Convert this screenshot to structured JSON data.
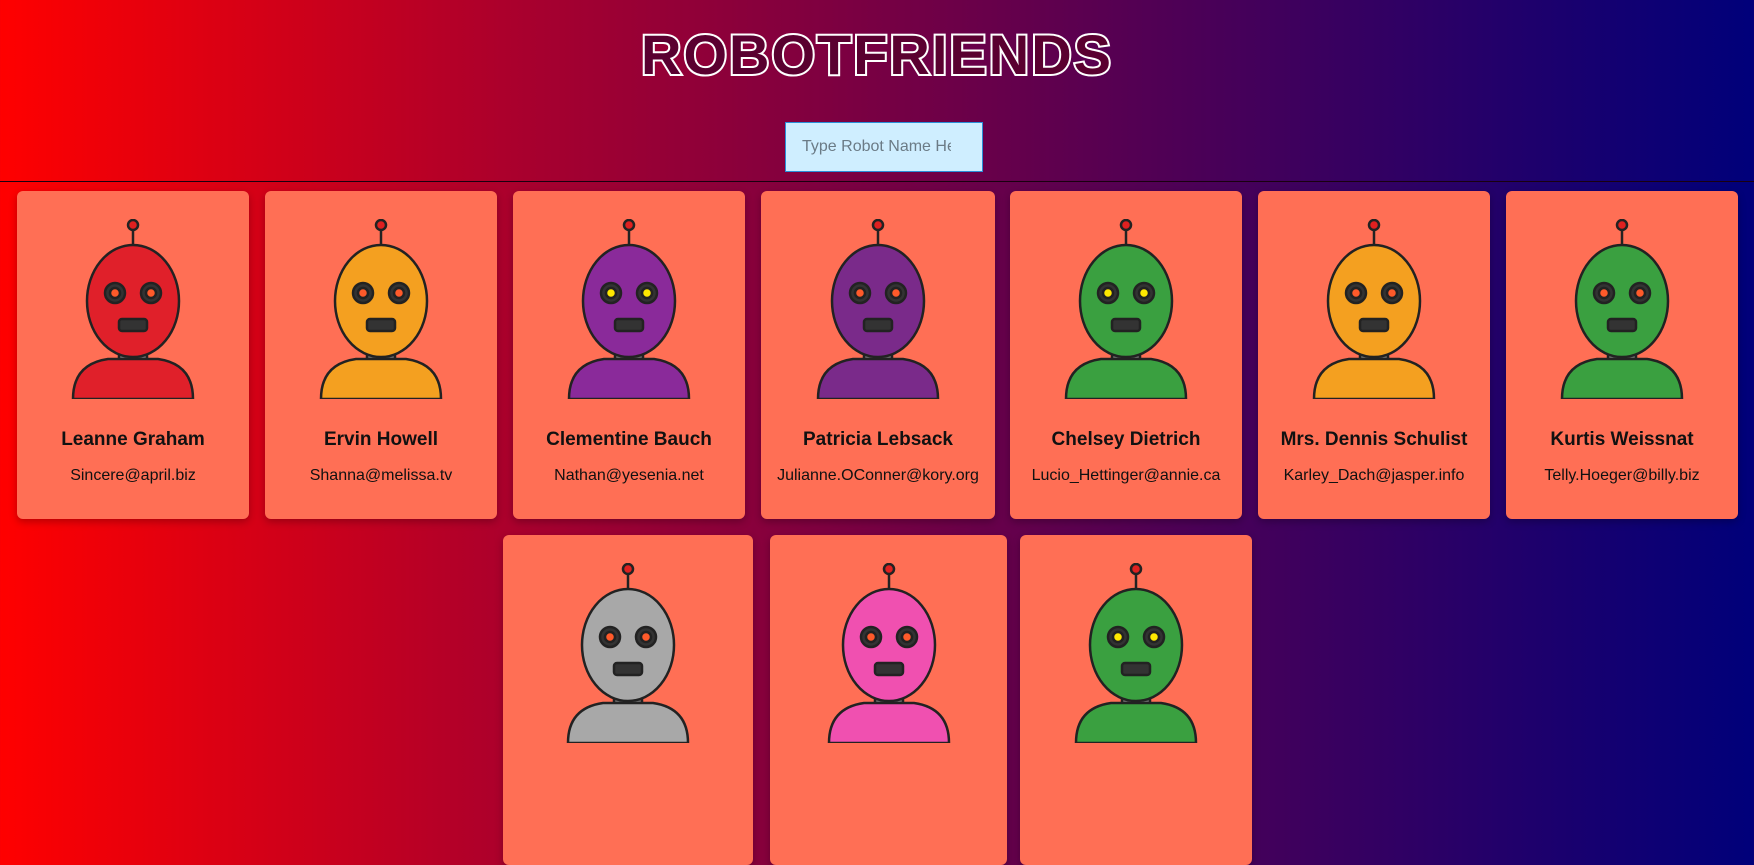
{
  "app": {
    "title": "ROBOTFRIENDS",
    "search_placeholder": "Type Robot Name Here"
  },
  "robots": [
    {
      "name": "Leanne Graham",
      "email": "Sincere@april.biz",
      "color": "#e0202a"
    },
    {
      "name": "Ervin Howell",
      "email": "Shanna@melissa.tv",
      "color": "#f4a020"
    },
    {
      "name": "Clementine Bauch",
      "email": "Nathan@yesenia.net",
      "color": "#8a2a9a"
    },
    {
      "name": "Patricia Lebsack",
      "email": "Julianne.OConner@kory.org",
      "color": "#7a2a8a"
    },
    {
      "name": "Chelsey Dietrich",
      "email": "Lucio_Hettinger@annie.ca",
      "color": "#3aa040"
    },
    {
      "name": "Mrs. Dennis Schulist",
      "email": "Karley_Dach@jasper.info",
      "color": "#f4a020"
    },
    {
      "name": "Kurtis Weissnat",
      "email": "Telly.Hoeger@billy.biz",
      "color": "#3aa040"
    },
    {
      "name": "",
      "email": "",
      "color": "#a8a8a8"
    },
    {
      "name": "",
      "email": "",
      "color": "#f050b0"
    },
    {
      "name": "",
      "email": "",
      "color": "#3aa040"
    }
  ]
}
